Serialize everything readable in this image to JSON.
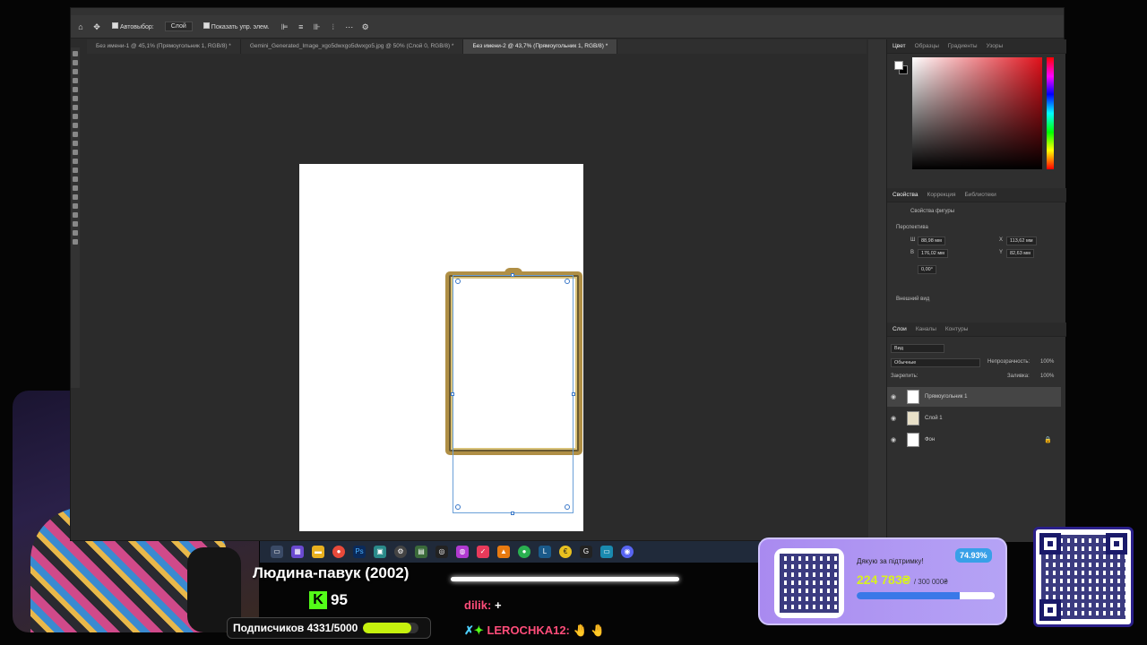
{
  "photoshop": {
    "options_bar": {
      "autoselect_label": "Автовыбор:",
      "autoselect_value": "Слой",
      "show_controls_label": "Показать упр. элем."
    },
    "tabs": [
      {
        "label": "Без имени-1 @ 45,1% (Прямоугольник 1, RGB/8) *"
      },
      {
        "label": "Gemini_Generated_Image_xgo5dwxgo5dwxgo5.jpg @ 50% (Слой 0, RGB/8) *"
      },
      {
        "label": "Без имени-2 @ 43,7% (Прямоугольник 1, RGB/8) *"
      }
    ],
    "active_tab": 2,
    "color_panel": {
      "tabs": [
        "Цвет",
        "Образцы",
        "Градиенты",
        "Узоры"
      ]
    },
    "properties_panel": {
      "tabs": [
        "Свойства",
        "Коррекция",
        "Библиотеки"
      ],
      "shape_props_label": "Свойства фигуры",
      "perspective_label": "Перспектива",
      "w_label": "Ш",
      "w_value": "88,98 мм",
      "h_label": "В",
      "h_value": "176,02 мм",
      "x_label": "X",
      "x_value": "113,62 мм",
      "y_label": "Y",
      "y_value": "82,63 мм",
      "angle_value": "0,00°",
      "appearance_label": "Внешний вид"
    },
    "layers_panel": {
      "tabs": [
        "Слои",
        "Каналы",
        "Контуры"
      ],
      "filter_label": "Вид",
      "blend_mode": "Обычные",
      "opacity_label": "Непрозрачность:",
      "opacity_value": "100%",
      "lock_label": "Закрепить:",
      "fill_label": "Заливка:",
      "fill_value": "100%",
      "layers": [
        {
          "name": "Прямоугольник 1",
          "selected": true
        },
        {
          "name": "Слой 1",
          "selected": false
        },
        {
          "name": "Фон",
          "selected": false,
          "locked": true
        }
      ]
    }
  },
  "taskbar": {
    "icons": [
      "file-explorer-icon",
      "apps-icon",
      "folder-icon",
      "chrome-icon",
      "photoshop-icon",
      "media-icon",
      "gear-icon",
      "xbox-icon",
      "blender-icon",
      "camera-icon",
      "vpn-icon",
      "vlc-icon",
      "spotify-icon",
      "lightshot-icon",
      "gold-icon",
      "g-icon",
      "monitor-icon",
      "discord-icon"
    ]
  },
  "overlay": {
    "title": "Людина-павук (2002)",
    "kick_badge": "K",
    "kick_count": "95",
    "subs_label": "Подписчиков 4331/5000",
    "subs_progress": 0.866,
    "chat": [
      {
        "user": "dilik:",
        "message": "+"
      },
      {
        "user": "LEROCHKA12:",
        "message": "🤚 🤚"
      }
    ]
  },
  "donation": {
    "thanks": "Дякую за підтримку!",
    "amount": "224 783₴",
    "goal": "/ 300 000₴",
    "percent_label": "74.93%",
    "percent": 0.7493
  },
  "colors": {
    "accent_kick": "#53fc18",
    "donation_bg": "#b5a3f5",
    "frame_gold": "#b08f45"
  }
}
